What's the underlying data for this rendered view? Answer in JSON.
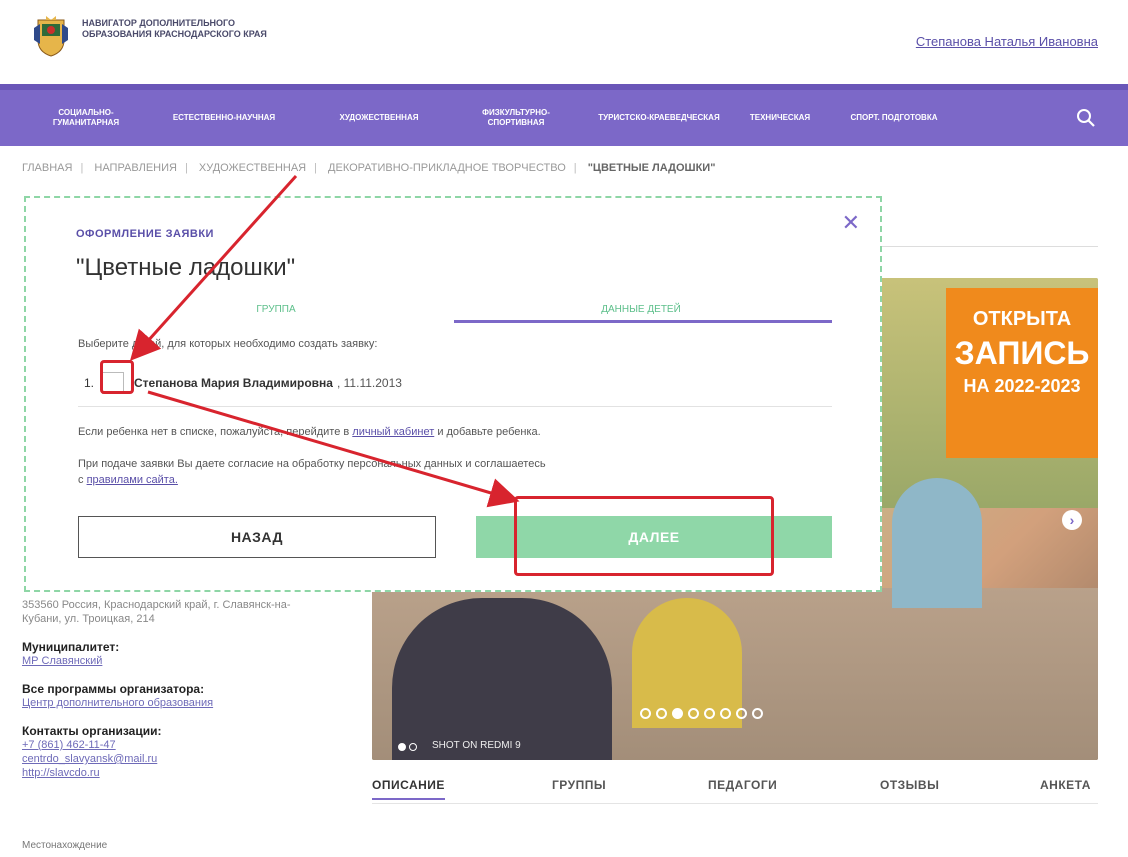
{
  "header": {
    "logo_text": "НАВИГАТОР ДОПОЛНИТЕЛЬНОГО ОБРАЗОВАНИЯ КРАСНОДАРСКОГО КРАЯ",
    "user_name": "Степанова Наталья Ивановна"
  },
  "nav": {
    "items": [
      "СОЦИАЛЬНО-ГУМАНИТАРНАЯ",
      "ЕСТЕСТВЕННО-НАУЧНАЯ",
      "ХУДОЖЕСТВЕННАЯ",
      "ФИЗКУЛЬТУРНО-СПОРТИВНАЯ",
      "ТУРИСТСКО-КРАЕВЕДЧЕСКАЯ",
      "ТЕХНИЧЕСКАЯ",
      "СПОРТ. ПОДГОТОВКА"
    ],
    "search_icon": "search-icon"
  },
  "breadcrumb": {
    "items": [
      "ГЛАВНАЯ",
      "НАПРАВЛЕНИЯ",
      "ХУДОЖЕСТВЕННАЯ",
      "ДЕКОРАТИВНО-ПРИКЛАДНОЕ ТВОРЧЕСТВО"
    ],
    "current": "\"ЦВЕТНЫЕ ЛАДОШКИ\""
  },
  "hero": {
    "promo_line1": "ОТКРЫТА",
    "promo_line2": "ЗАПИСЬ",
    "promo_line3": "НА 2022-2023",
    "watermark": "SHOT ON REDMI 9"
  },
  "tabs": [
    "ОПИСАНИЕ",
    "ГРУППЫ",
    "ПЕДАГОГИ",
    "ОТЗЫВЫ",
    "АНКЕТА"
  ],
  "sidebar": {
    "address": "353560 Россия, Краснодарский край, г. Славянск-на-Кубани, ул. Троицкая, 214",
    "municipality_label": "Муниципалитет:",
    "municipality_value": "МР Славянский",
    "programs_label": "Все программы организатора:",
    "programs_value": "Центр дополнительного образования",
    "contacts_label": "Контакты организации:",
    "phone": "+7 (861) 462-11-47",
    "email": "centrdo_slavyansk@mail.ru",
    "site": "http://slavcdo.ru"
  },
  "footer": {
    "text": "Местонахождение"
  },
  "modal": {
    "heading": "ОФОРМЛЕНИЕ ЗАЯВКИ",
    "title": "\"Цветные ладошки\"",
    "step1": "ГРУППА",
    "step2": "ДАННЫЕ ДЕТЕЙ",
    "choose_text": "Выберите детей, для которых необходимо создать заявку:",
    "child": {
      "num": "1.",
      "name": "Степанова Мария Владимировна",
      "dob": ", 11.11.2013",
      "checked": false
    },
    "hint_pre": "Если ребенка нет в списке, пожалуйста, перейдите в",
    "hint_link": "личный кабинет",
    "hint_post": "и добавьте ребенка.",
    "consent_pre": "При подаче заявки Вы даете согласие на обработку персональных данных и соглашаетесь",
    "consent_with": "с",
    "consent_link": "правилами сайта.",
    "back_label": "НАЗАД",
    "next_label": "ДАЛЕЕ",
    "close_icon": "close-icon"
  },
  "colors": {
    "brand_purple": "#7c68c8",
    "next_green": "#8fd7a8",
    "highlight_red": "#d8242e",
    "promo_orange": "#f08a1c"
  }
}
